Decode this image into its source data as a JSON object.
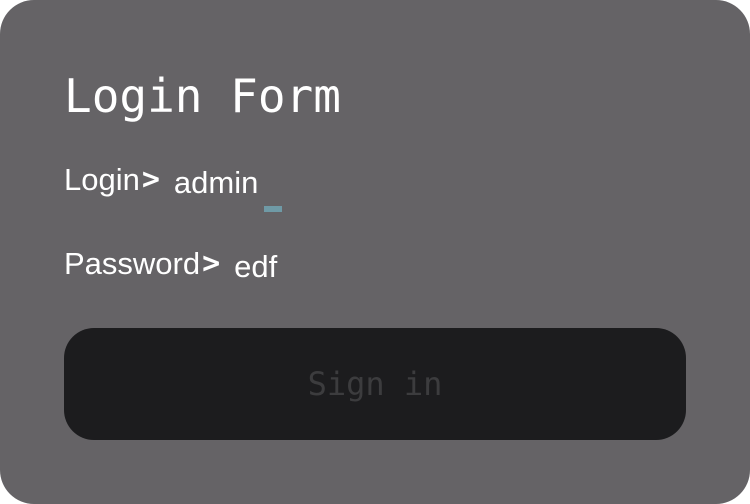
{
  "form": {
    "title": "Login Form",
    "login": {
      "label": "Login",
      "prompt": ">",
      "value": "admin"
    },
    "password": {
      "label": "Password",
      "prompt": ">",
      "value": "edf"
    },
    "submit_label": "Sign in"
  },
  "colors": {
    "card_background": "#656366",
    "button_background": "#1c1c1e",
    "button_text": "#3c3c3e",
    "cursor": "#6f9aa6",
    "text": "#ffffff"
  }
}
